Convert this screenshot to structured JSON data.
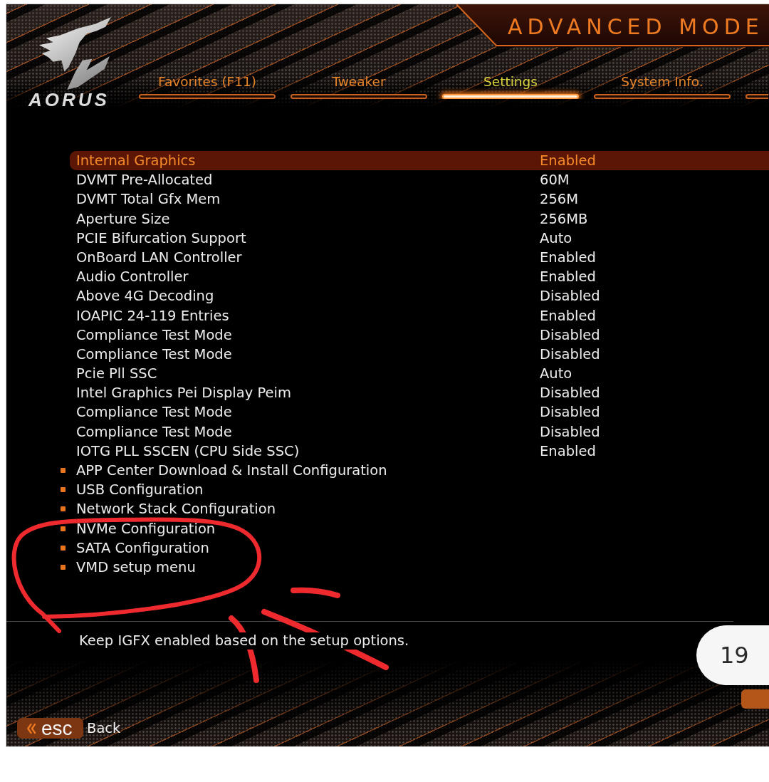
{
  "brand": {
    "name": "AORUS"
  },
  "mode_banner": {
    "title": "ADVANCED MODE"
  },
  "tabs": [
    {
      "label": "Favorites (F11)",
      "selected": false
    },
    {
      "label": "Tweaker",
      "selected": false
    },
    {
      "label": "Settings",
      "selected": true
    },
    {
      "label": "System Info.",
      "selected": false
    }
  ],
  "settings": [
    {
      "kind": "option",
      "label": "Internal Graphics",
      "value": "Enabled",
      "selected": true
    },
    {
      "kind": "option",
      "label": "DVMT Pre-Allocated",
      "value": "60M",
      "selected": false
    },
    {
      "kind": "option",
      "label": "DVMT Total Gfx Mem",
      "value": "256M",
      "selected": false
    },
    {
      "kind": "option",
      "label": "Aperture Size",
      "value": "256MB",
      "selected": false
    },
    {
      "kind": "option",
      "label": "PCIE Bifurcation Support",
      "value": "Auto",
      "selected": false
    },
    {
      "kind": "option",
      "label": "OnBoard LAN Controller",
      "value": "Enabled",
      "selected": false
    },
    {
      "kind": "option",
      "label": "Audio Controller",
      "value": "Enabled",
      "selected": false
    },
    {
      "kind": "option",
      "label": "Above 4G Decoding",
      "value": "Disabled",
      "selected": false
    },
    {
      "kind": "option",
      "label": "IOAPIC 24-119 Entries",
      "value": "Enabled",
      "selected": false
    },
    {
      "kind": "option",
      "label": "Compliance Test Mode",
      "value": "Disabled",
      "selected": false
    },
    {
      "kind": "option",
      "label": "Compliance Test Mode",
      "value": "Disabled",
      "selected": false
    },
    {
      "kind": "option",
      "label": "Pcie Pll SSC",
      "value": "Auto",
      "selected": false
    },
    {
      "kind": "option",
      "label": "Intel Graphics Pei Display Peim",
      "value": "Disabled",
      "selected": false
    },
    {
      "kind": "option",
      "label": "Compliance Test Mode",
      "value": "Disabled",
      "selected": false
    },
    {
      "kind": "option",
      "label": "Compliance Test Mode",
      "value": "Disabled",
      "selected": false
    },
    {
      "kind": "option",
      "label": "IOTG PLL SSCEN (CPU Side SSC)",
      "value": "Enabled",
      "selected": false
    },
    {
      "kind": "submenu",
      "label": "APP Center Download & Install Configuration",
      "selected": false
    },
    {
      "kind": "submenu",
      "label": "USB Configuration",
      "selected": false
    },
    {
      "kind": "submenu",
      "label": "Network Stack Configuration",
      "selected": false
    },
    {
      "kind": "submenu",
      "label": "NVMe Configuration",
      "selected": false
    },
    {
      "kind": "submenu",
      "label": "SATA Configuration",
      "selected": false
    },
    {
      "kind": "submenu",
      "label": "VMD setup menu",
      "selected": false
    }
  ],
  "help_text": "Keep IGFX enabled based on the setup options.",
  "footer": {
    "key": "esc",
    "action": "Back"
  },
  "page_badge": "19"
}
